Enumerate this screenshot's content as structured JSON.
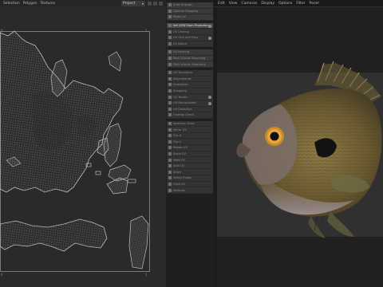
{
  "uv_editor": {
    "header_items": [
      "Selection",
      "Polygon",
      "Textures"
    ],
    "project_select": "Project",
    "corner_ticks": [
      "0",
      "1",
      "1",
      "0"
    ]
  },
  "tool_panel": {
    "items": [
      {
        "label": "Auto-Unwrap",
        "icon": "unwrap-icon",
        "style": "lite",
        "toggle": false
      },
      {
        "label": "Optimal Mapping",
        "icon": "map-icon",
        "style": "lite",
        "toggle": false
      },
      {
        "label": "Relax UV",
        "icon": "relax-icon",
        "style": "lite",
        "toggle": false
      },
      {
        "label": "Set UVW From Projection",
        "icon": "projection-icon",
        "style": "hl",
        "toggle": true
      },
      {
        "label": "UV Unwrap",
        "icon": "unwrap-icon",
        "style": "dark",
        "toggle": false
      },
      {
        "label": "UV Grid and Flow",
        "icon": "grid-icon",
        "style": "dark",
        "toggle": true
      },
      {
        "label": "UV Island",
        "icon": "island-icon",
        "style": "dark",
        "toggle": false
      },
      {
        "label": "UV Packing",
        "icon": "pack-icon",
        "style": "lite",
        "toggle": false
      },
      {
        "label": "Pack Islands Bounding",
        "icon": "bound-icon",
        "style": "lite",
        "toggle": false
      },
      {
        "label": "Pack Islands Geometry",
        "icon": "geometry-icon",
        "style": "lite",
        "toggle": false
      },
      {
        "label": "UV Transform",
        "icon": "transform-icon",
        "style": "dark",
        "toggle": false
      },
      {
        "label": "Align Islands",
        "icon": "align-icon",
        "style": "dark",
        "toggle": false
      },
      {
        "label": "Straighten",
        "icon": "straighten-icon",
        "style": "dark",
        "toggle": false
      },
      {
        "label": "Snapping",
        "icon": "snap-icon",
        "style": "dark",
        "toggle": false
      },
      {
        "label": "UV Terrain",
        "icon": "terrain-icon",
        "style": "dark",
        "toggle": true
      },
      {
        "label": "UV Manipulation",
        "icon": "manip-icon",
        "style": "dark",
        "toggle": true
      },
      {
        "label": "UV Distortion",
        "icon": "distort-icon",
        "style": "dark",
        "toggle": false
      },
      {
        "label": "Overlap Check",
        "icon": "overlap-icon",
        "style": "dark",
        "toggle": false
      },
      {
        "label": "Selection Tools",
        "icon": "select-icon",
        "style": "dark",
        "toggle": false
      },
      {
        "label": "Mirror UV",
        "icon": "mirror-icon",
        "style": "dark",
        "toggle": false
      },
      {
        "label": "Flip U",
        "icon": "flip-icon",
        "style": "dark",
        "toggle": false
      },
      {
        "label": "Flip V",
        "icon": "flip-icon",
        "style": "dark",
        "toggle": false
      },
      {
        "label": "Rotate UV",
        "icon": "rotate-icon",
        "style": "dark",
        "toggle": false
      },
      {
        "label": "Scale UV",
        "icon": "scale-icon",
        "style": "dark",
        "toggle": false
      },
      {
        "label": "Weld UV",
        "icon": "weld-icon",
        "style": "dark",
        "toggle": false
      },
      {
        "label": "Split UV",
        "icon": "split-icon",
        "style": "dark",
        "toggle": false
      },
      {
        "label": "Stitch",
        "icon": "stitch-icon",
        "style": "dark",
        "toggle": false
      },
      {
        "label": "Select Edges",
        "icon": "edge-icon",
        "style": "dark",
        "toggle": false
      },
      {
        "label": "Grab UV",
        "icon": "grab-icon",
        "style": "dark",
        "toggle": false
      },
      {
        "label": "Settings",
        "icon": "gear-icon",
        "style": "dark",
        "toggle": false
      }
    ]
  },
  "viewport": {
    "header_items": [
      "Edit",
      "View",
      "Cameras",
      "Display",
      "Options",
      "Filter",
      "Panel"
    ]
  },
  "colors": {
    "uv_wire": "#9c9c9c",
    "fish_body": "#7a6a3a",
    "fish_belly": "#8a7e7e"
  }
}
